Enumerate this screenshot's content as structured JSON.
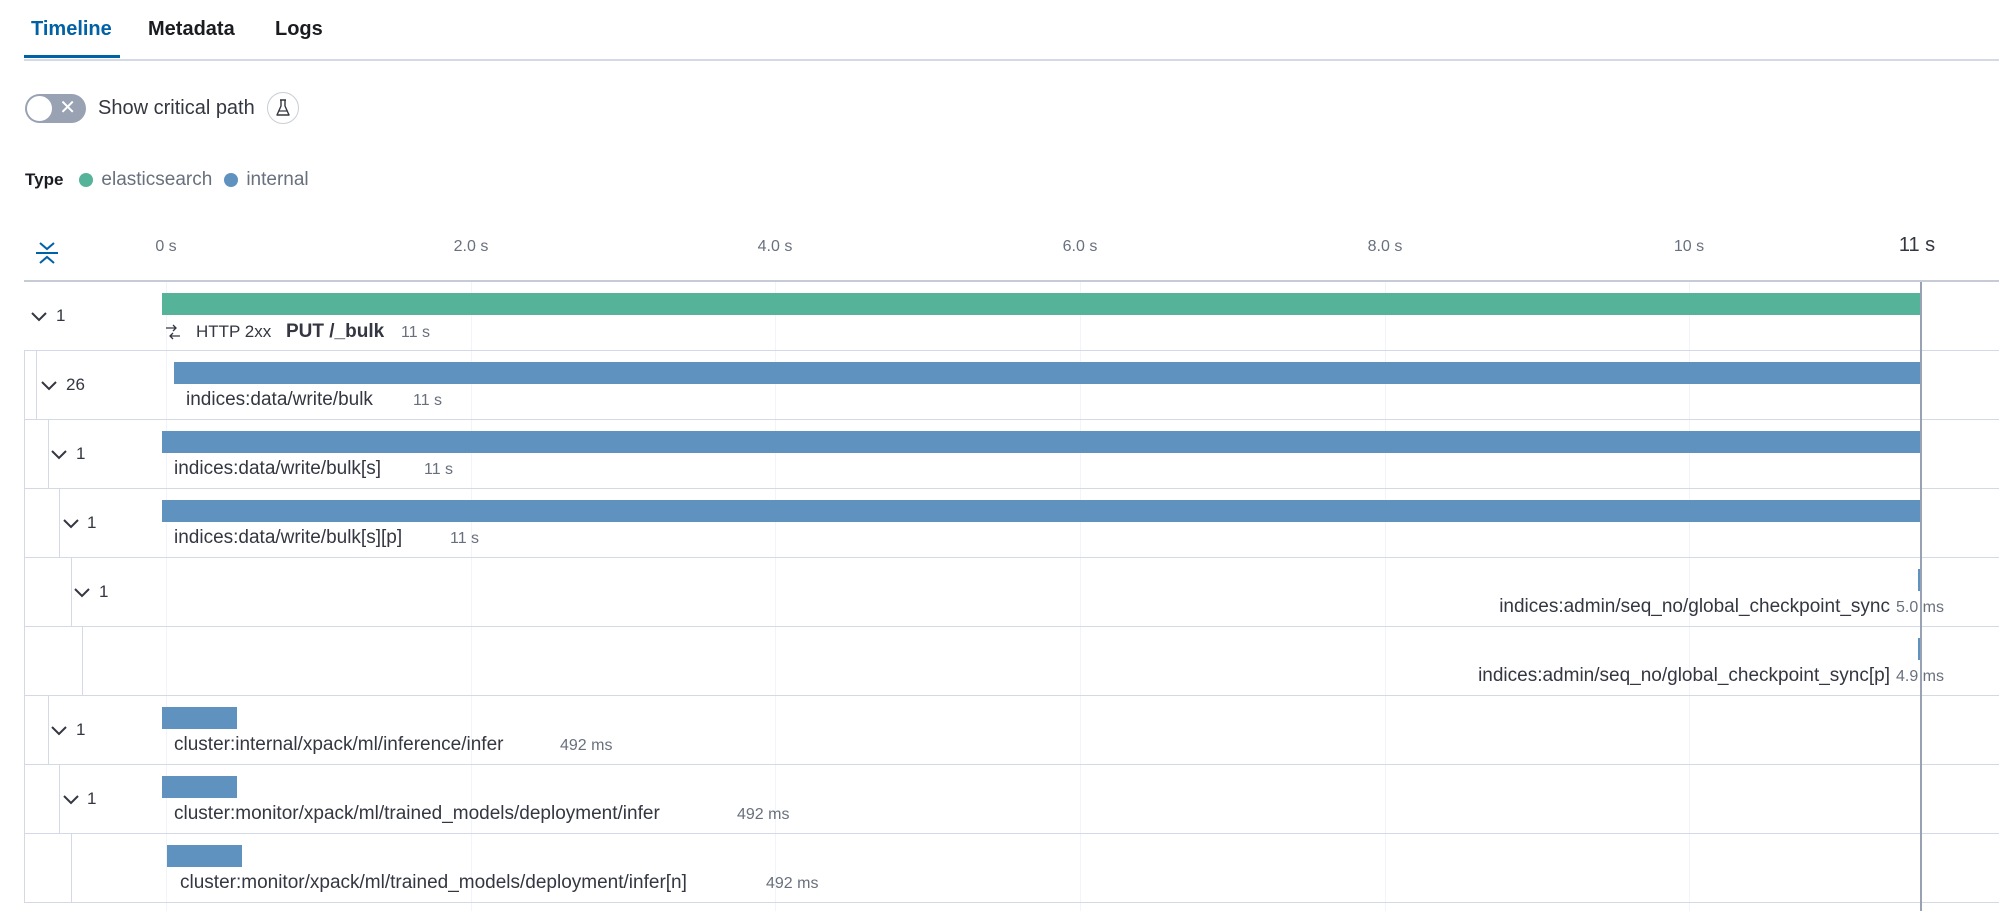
{
  "tabs": [
    "Timeline",
    "Metadata",
    "Logs"
  ],
  "critical_path": {
    "label": "Show critical path",
    "enabled": false
  },
  "legend": {
    "title": "Type",
    "items": [
      {
        "label": "elasticsearch",
        "color": "#54b399"
      },
      {
        "label": "internal",
        "color": "#6092c0"
      }
    ]
  },
  "axis": {
    "ticks": [
      "0 s",
      "2.0 s",
      "4.0 s",
      "6.0 s",
      "8.0 s",
      "10 s"
    ],
    "end": "11 s"
  },
  "colors": {
    "elasticsearch": "#54b399",
    "internal": "#6092c0",
    "accent": "#0061a6"
  },
  "spans": [
    {
      "count": "1",
      "status": "HTTP 2xx",
      "name": "PUT /_bulk",
      "duration": "11 s",
      "type": "elasticsearch"
    },
    {
      "count": "26",
      "name": "indices:data/write/bulk",
      "duration": "11 s",
      "type": "internal"
    },
    {
      "count": "1",
      "name": "indices:data/write/bulk[s]",
      "duration": "11 s",
      "type": "internal"
    },
    {
      "count": "1",
      "name": "indices:data/write/bulk[s][p]",
      "duration": "11 s",
      "type": "internal"
    },
    {
      "count": "1",
      "name": "indices:admin/seq_no/global_checkpoint_sync",
      "duration": "5.0 ms",
      "type": "internal"
    },
    {
      "count": "",
      "name": "indices:admin/seq_no/global_checkpoint_sync[p]",
      "duration": "4.9 ms",
      "type": "internal"
    },
    {
      "count": "1",
      "name": "cluster:internal/xpack/ml/inference/infer",
      "duration": "492 ms",
      "type": "internal"
    },
    {
      "count": "1",
      "name": "cluster:monitor/xpack/ml/trained_models/deployment/infer",
      "duration": "492 ms",
      "type": "internal"
    },
    {
      "count": "",
      "name": "cluster:monitor/xpack/ml/trained_models/deployment/infer[n]",
      "duration": "492 ms",
      "type": "internal"
    }
  ]
}
